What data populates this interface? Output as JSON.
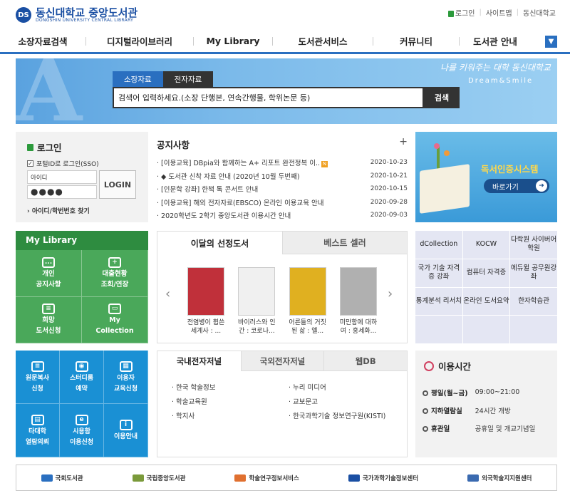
{
  "header": {
    "logo_title": "동신대학교 중앙도서관",
    "logo_sub": "DONGSHIN UNIVERSITY CENTRAL LIBRARY",
    "links": [
      "로그인",
      "사이트맵",
      "동신대학교"
    ]
  },
  "nav": [
    "소장자료검색",
    "디지털라이브러리",
    "My Library",
    "도서관서비스",
    "커뮤니티",
    "도서관 안내"
  ],
  "search": {
    "tabs": [
      "소장자료",
      "전자자료"
    ],
    "placeholder": "검색어 입력하세요.(소장 단행본, 연속간행물, 학위논문 등)",
    "button": "검색",
    "slogan": "나를 키워주는 대학 동신대학교",
    "slogan2": "Dream&Smile"
  },
  "login": {
    "title": "로그인",
    "sso": "포털ID로 로그인(SSO)",
    "id_placeholder": "아이디",
    "password": "●●●●",
    "button": "LOGIN",
    "find": "아이디/학번번호 찾기"
  },
  "notice": {
    "title": "공지사항",
    "more": "+",
    "items": [
      {
        "t": "[이용교육] DBpia와 함께하는 A+ 리포트 완전정복 이..",
        "d": "2020-10-23",
        "new": "N"
      },
      {
        "t": "◆ 도서관 신착 자료 안내 (2020년 10월 두번째)",
        "d": "2020-10-21"
      },
      {
        "t": "[인문학 강좌] 한책 톡 콘서트 안내",
        "d": "2020-10-15"
      },
      {
        "t": "[이용교육] 해외 전자자료(EBSCO) 온라인 이용교육 안내",
        "d": "2020-09-28"
      },
      {
        "t": "2020학년도 2학기 중앙도서관 이용시간 안내",
        "d": "2020-09-03"
      }
    ]
  },
  "auth": {
    "title": "독서인증시스템",
    "button": "바로가기"
  },
  "mylib": {
    "title": "My Library",
    "items": [
      {
        "l1": "개인",
        "l2": "공지사항",
        "icon": "..."
      },
      {
        "l1": "대출현황",
        "l2": "조회/연장",
        "icon": "+"
      },
      {
        "l1": "희망",
        "l2": "도서신청",
        "icon": "≡"
      },
      {
        "l1": "My",
        "l2": "Collection",
        "icon": "▭"
      }
    ]
  },
  "books": {
    "tabs": [
      "이달의 선정도서",
      "베스트 셀러"
    ],
    "items": [
      {
        "l1": "전염병이 휩쓴",
        "l2": "세계사 : ...",
        "color": "#c0303a"
      },
      {
        "l1": "바이러스와 인",
        "l2": "간 : 코로나...",
        "color": "#f0f0f0"
      },
      {
        "l1": "어른들의 거짓",
        "l2": "된 삶 : 엘...",
        "color": "#e0b020"
      },
      {
        "l1": "미만함에 대하",
        "l2": "여 : 홍세화...",
        "color": "#b0b0b0"
      }
    ]
  },
  "db": [
    "dCollection",
    "KOCW",
    "다락원 사이버어학원",
    "국가 기술 자격증 강좌",
    "컴퓨터 자격증",
    "에듀윌 공무원강좌",
    "통계분석 리서치",
    "온라인 도서요약",
    "한자학습관",
    "",
    "",
    ""
  ],
  "svc": [
    {
      "l1": "원문복사",
      "l2": "신청",
      "icon": "≡"
    },
    {
      "l1": "스터디룸",
      "l2": "예약",
      "icon": "◉"
    },
    {
      "l1": "이용자",
      "l2": "교육신청",
      "icon": "▦"
    },
    {
      "l1": "타대학",
      "l2": "열람의뢰",
      "icon": "▤"
    },
    {
      "l1": "시용함",
      "l2": "이용신청",
      "icon": "e"
    },
    {
      "l1": "이용안내",
      "l2": "",
      "icon": "i"
    }
  ],
  "ejournal": {
    "tabs": [
      "국내전자저널",
      "국외전자저널",
      "웹DB"
    ],
    "col1": [
      "한국 학술정보",
      "학술교육원",
      "학지사"
    ],
    "col2": [
      "누리 미디어",
      "교보문고",
      "한국과학기술 정보연구원(KISTI)"
    ]
  },
  "hours": {
    "title": "이용시간",
    "rows": [
      {
        "k": "평일(월~금)",
        "v": "09:00~21:00"
      },
      {
        "k": "지하열람실",
        "v": "24시간 개방"
      },
      {
        "k": "휴관일",
        "v": "공휴일 및 개교기념일"
      }
    ]
  },
  "footer": [
    {
      "name": "국회도서관",
      "color": "#2a6fc0"
    },
    {
      "name": "국립중앙도서관",
      "color": "#7a9a3a"
    },
    {
      "name": "학술연구정보서비스",
      "color": "#e07030"
    },
    {
      "name": "국가과학기술정보센터",
      "color": "#1a4fa3"
    },
    {
      "name": "외국학술지지원센터",
      "color": "#3a6ab0"
    }
  ]
}
